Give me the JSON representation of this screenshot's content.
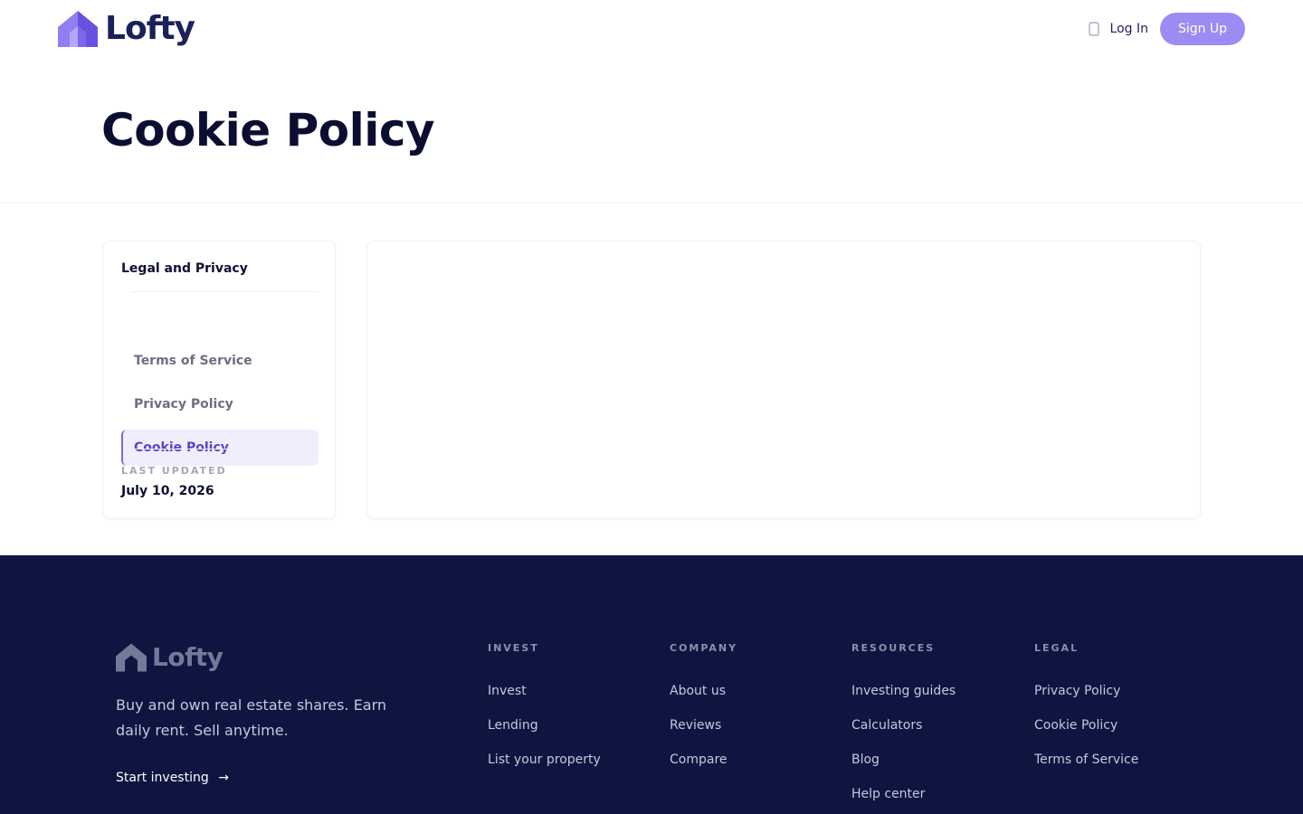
{
  "header": {
    "brand": "Lofty",
    "login_label": "Log In",
    "signup_label": "Sign Up",
    "accent_color": "#9b8cf3",
    "icons": {
      "logo": "house-logo-icon",
      "language": "globe-icon"
    }
  },
  "hero": {
    "title": "Cookie Policy"
  },
  "sidebar": {
    "heading": "Legal and Privacy",
    "items": [
      {
        "label": "Terms of Service",
        "active": false
      },
      {
        "label": "Privacy Policy",
        "active": false
      },
      {
        "label": "Cookie Policy",
        "active": true
      }
    ],
    "last_updated_label": "LAST UPDATED",
    "last_updated_date": "July 10, 2026"
  },
  "footer": {
    "brand": "Lofty",
    "tagline": "Buy and own real estate shares. Earn daily rent. Sell anytime.",
    "cta": "Start investing",
    "cta_arrow": "→",
    "background_color": "#0e1541",
    "columns": [
      {
        "title": "INVEST",
        "links": [
          "Invest",
          "Lending",
          "List your property"
        ]
      },
      {
        "title": "COMPANY",
        "links": [
          "About us",
          "Reviews",
          "Compare"
        ]
      },
      {
        "title": "RESOURCES",
        "links": [
          "Investing guides",
          "Calculators",
          "Blog",
          "Help center"
        ]
      },
      {
        "title": "LEGAL",
        "links": [
          "Privacy Policy",
          "Cookie Policy",
          "Terms of Service"
        ]
      }
    ]
  }
}
